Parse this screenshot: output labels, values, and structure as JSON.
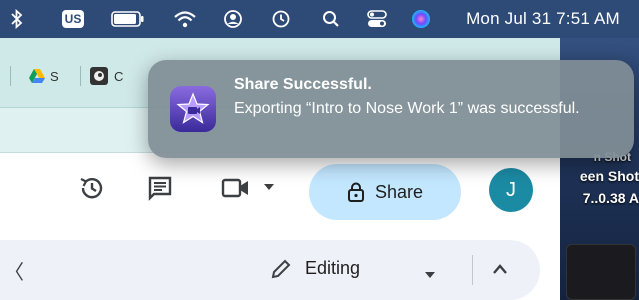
{
  "menubar": {
    "input_source": "US",
    "date_time": "Mon Jul 31  7:51 AM",
    "icons": [
      "bluetooth-icon",
      "battery-icon",
      "wifi-icon",
      "user-icon",
      "time-machine-icon",
      "search-icon",
      "control-center-icon",
      "siri-icon"
    ]
  },
  "desktop": {
    "file_label_1": "een Shot",
    "file_label_2": "7..0.38 A",
    "file_label_partial": "n Shot"
  },
  "bookmarks": {
    "items": [
      {
        "icon": "google-drive-icon",
        "label": "S"
      },
      {
        "icon": "bookmark-favicon-icon",
        "label": "C"
      }
    ]
  },
  "toolbar": {
    "share_label": "Share",
    "avatar_initial": "J",
    "icons": [
      "history-icon",
      "comments-icon",
      "meet-icon",
      "chevron-down-icon",
      "lock-icon"
    ]
  },
  "editbar": {
    "mode_label": "Editing",
    "left_glyph": "〈"
  },
  "notification": {
    "app": "iMovie",
    "title": "Share Successful.",
    "body": "Exporting “Intro to Nose Work 1” was successful."
  },
  "colors": {
    "share_button_bg": "#c2e7ff",
    "avatar_bg": "#1b8aa3",
    "bookmarks_bg": "#cfe8e8",
    "menubar_bg": "#2e4b78"
  }
}
